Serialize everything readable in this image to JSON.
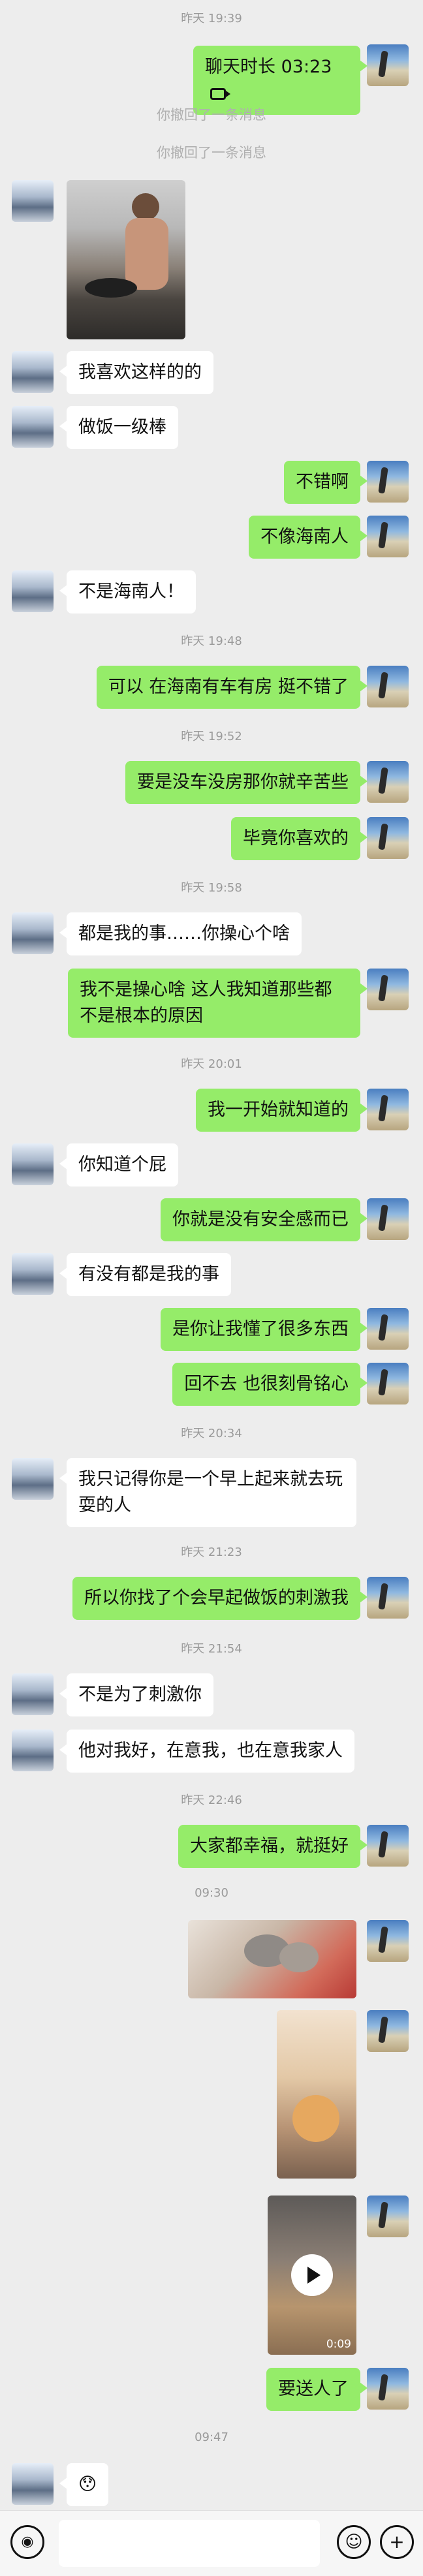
{
  "messages": [
    {
      "type": "time",
      "text": "昨天 19:39"
    },
    {
      "type": "call",
      "from": "me",
      "text": "聊天时长 03:23"
    },
    {
      "type": "system",
      "text": "你撤回了一条消息"
    },
    {
      "type": "system",
      "text": "你撤回了一条消息"
    },
    {
      "type": "image",
      "from": "them",
      "desc": "man-cooking-photo"
    },
    {
      "type": "text",
      "from": "them",
      "text": "我喜欢这样的的"
    },
    {
      "type": "text",
      "from": "them",
      "text": "做饭一级棒"
    },
    {
      "type": "text",
      "from": "me",
      "text": "不错啊"
    },
    {
      "type": "text",
      "from": "me",
      "text": "不像海南人"
    },
    {
      "type": "text",
      "from": "them",
      "text": "不是海南人！"
    },
    {
      "type": "time",
      "text": "昨天 19:48"
    },
    {
      "type": "text",
      "from": "me",
      "text": "可以 在海南有车有房 挺不错了"
    },
    {
      "type": "time",
      "text": "昨天 19:52"
    },
    {
      "type": "text",
      "from": "me",
      "text": "要是没车没房那你就辛苦些"
    },
    {
      "type": "text",
      "from": "me",
      "text": "毕竟你喜欢的"
    },
    {
      "type": "time",
      "text": "昨天 19:58"
    },
    {
      "type": "text",
      "from": "them",
      "text": "都是我的事……你操心个啥"
    },
    {
      "type": "text",
      "from": "me",
      "text": "我不是操心啥 这人我知道那些都不是根本的原因"
    },
    {
      "type": "time",
      "text": "昨天 20:01"
    },
    {
      "type": "text",
      "from": "me",
      "text": "我一开始就知道的"
    },
    {
      "type": "text",
      "from": "them",
      "text": "你知道个屁"
    },
    {
      "type": "text",
      "from": "me",
      "text": "你就是没有安全感而已"
    },
    {
      "type": "text",
      "from": "them",
      "text": "有没有都是我的事"
    },
    {
      "type": "text",
      "from": "me",
      "text": "是你让我懂了很多东西"
    },
    {
      "type": "text",
      "from": "me",
      "text": "回不去 也很刻骨铭心"
    },
    {
      "type": "time",
      "text": "昨天 20:34"
    },
    {
      "type": "text",
      "from": "them",
      "text": "我只记得你是一个早上起来就去玩耍的人"
    },
    {
      "type": "time",
      "text": "昨天 21:23"
    },
    {
      "type": "text",
      "from": "me",
      "text": "所以你找了个会早起做饭的刺激我"
    },
    {
      "type": "time",
      "text": "昨天 21:54"
    },
    {
      "type": "text",
      "from": "them",
      "text": "不是为了刺激你"
    },
    {
      "type": "text",
      "from": "them",
      "text": "他对我好，在意我，也在意我家人"
    },
    {
      "type": "time",
      "text": "昨天 22:46"
    },
    {
      "type": "text",
      "from": "me",
      "text": "大家都幸福，就挺好"
    },
    {
      "type": "time",
      "text": "09:30"
    },
    {
      "type": "image",
      "from": "me",
      "desc": "kittens-photo"
    },
    {
      "type": "image",
      "from": "me",
      "desc": "kitten-photo"
    },
    {
      "type": "video",
      "from": "me",
      "duration": "0:09"
    },
    {
      "type": "text",
      "from": "me",
      "text": "要送人了"
    },
    {
      "type": "time",
      "text": "09:47"
    },
    {
      "type": "emoji",
      "from": "them",
      "text": "😯"
    }
  ],
  "input_bar": {
    "voice_icon": "voice-icon",
    "emoji_icon": "emoji-icon",
    "plus_icon": "plus-icon"
  }
}
